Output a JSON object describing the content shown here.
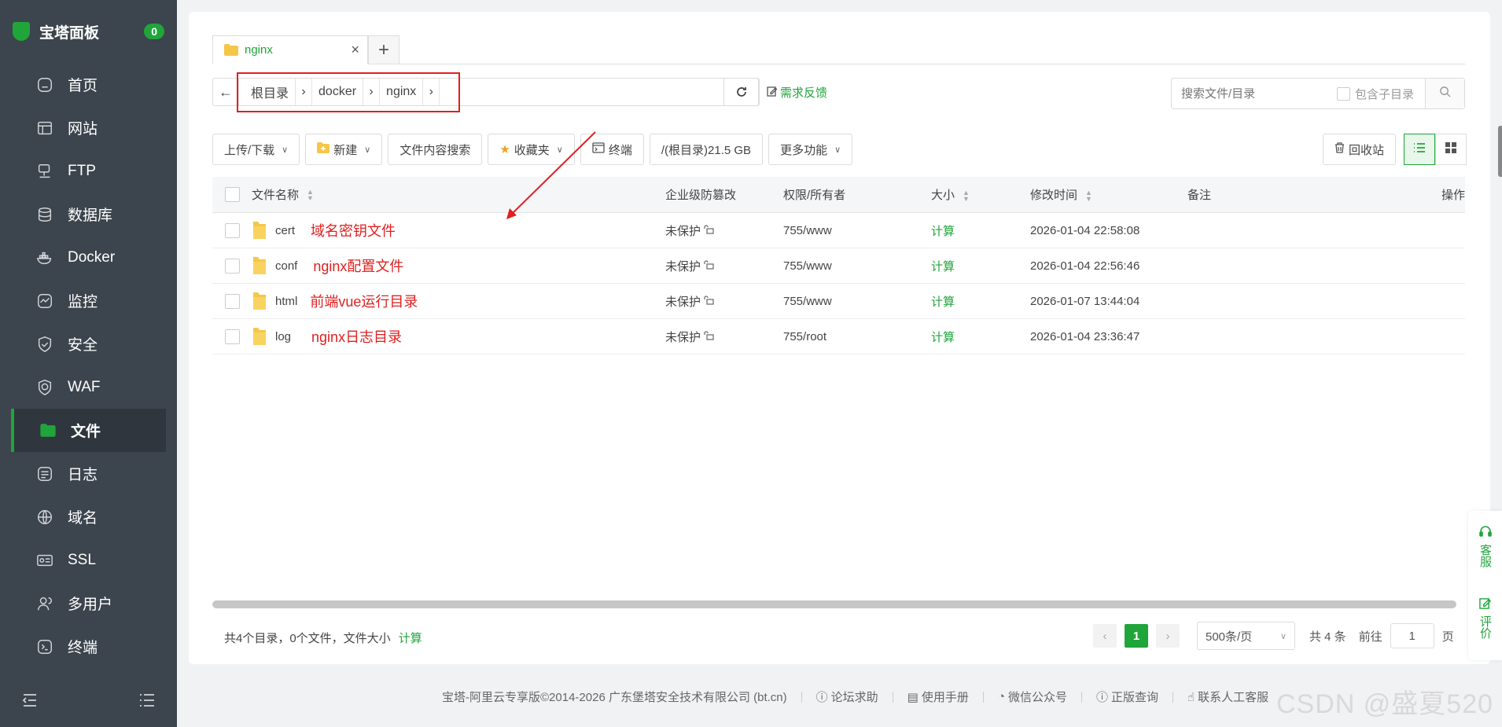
{
  "sidebar": {
    "brand": "宝塔面板",
    "badge": "0",
    "items": [
      {
        "label": "首页",
        "icon": "home-icon"
      },
      {
        "label": "网站",
        "icon": "website-icon"
      },
      {
        "label": "FTP",
        "icon": "ftp-icon"
      },
      {
        "label": "数据库",
        "icon": "database-icon"
      },
      {
        "label": "Docker",
        "icon": "docker-icon"
      },
      {
        "label": "监控",
        "icon": "monitor-icon"
      },
      {
        "label": "安全",
        "icon": "shield-icon"
      },
      {
        "label": "WAF",
        "icon": "waf-icon"
      },
      {
        "label": "文件",
        "icon": "folder-icon",
        "active": true
      },
      {
        "label": "日志",
        "icon": "log-icon"
      },
      {
        "label": "域名",
        "icon": "globe-icon"
      },
      {
        "label": "SSL",
        "icon": "ssl-icon"
      },
      {
        "label": "多用户",
        "icon": "users-icon"
      },
      {
        "label": "终端",
        "icon": "terminal-icon"
      }
    ]
  },
  "tabs": [
    {
      "label": "nginx"
    }
  ],
  "path": {
    "crumbs": [
      "根目录",
      "docker",
      "nginx"
    ],
    "feedback": "需求反馈"
  },
  "search": {
    "placeholder": "搜索文件/目录",
    "subdir_label": "包含子目录"
  },
  "toolbar": {
    "upload": "上传/下载",
    "new": "新建",
    "content_search": "文件内容搜索",
    "favorites": "收藏夹",
    "terminal": "终端",
    "disk": "/(根目录)21.5 GB",
    "more": "更多功能",
    "recycle": "回收站"
  },
  "table": {
    "headers": {
      "name": "文件名称",
      "protect": "企业级防篡改",
      "perm": "权限/所有者",
      "size": "大小",
      "mtime": "修改时间",
      "note": "备注",
      "ops": "操作"
    },
    "rows": [
      {
        "name": "cert",
        "annotation": "域名密钥文件",
        "protect": "未保护",
        "perm": "755/www",
        "size": "计算",
        "mtime": "2026-01-04 22:58:08"
      },
      {
        "name": "conf",
        "annotation": "nginx配置文件",
        "protect": "未保护",
        "perm": "755/www",
        "size": "计算",
        "mtime": "2026-01-04 22:56:46"
      },
      {
        "name": "html",
        "annotation": "前端vue运行目录",
        "protect": "未保护",
        "perm": "755/www",
        "size": "计算",
        "mtime": "2026-01-07 13:44:04"
      },
      {
        "name": "log",
        "annotation": "nginx日志目录",
        "protect": "未保护",
        "perm": "755/root",
        "size": "计算",
        "mtime": "2026-01-04 23:36:47"
      }
    ]
  },
  "footer": {
    "summary": "共4个目录，0个文件，文件大小",
    "calc": "计算",
    "page": "1",
    "page_size": "500条/页",
    "total": "共 4 条",
    "goto": "前往",
    "goto_value": "1",
    "page_unit": "页"
  },
  "bottom": {
    "copyright": "宝塔-阿里云专享版©2014-2026 广东堡塔安全技术有限公司 (bt.cn)",
    "forum": "论坛求助",
    "manual": "使用手册",
    "wechat": "微信公众号",
    "genuine": "正版查询",
    "support": "联系人工客服"
  },
  "float": {
    "service": "客服",
    "review": "评价"
  },
  "watermark": "CSDN @盛夏520",
  "colors": {
    "accent": "#20a53a",
    "sidebar": "#3c444d",
    "annotation": "#e02020"
  }
}
